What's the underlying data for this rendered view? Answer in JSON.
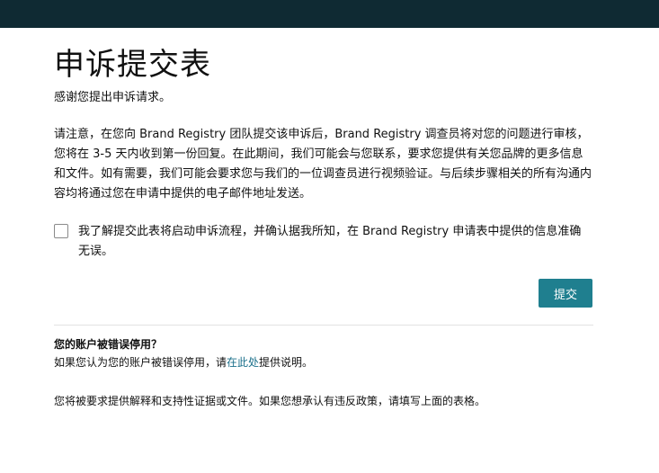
{
  "header": {
    "bar_color": "#0f2a33"
  },
  "page": {
    "title": "申诉提交表",
    "thanks": "感谢您提出申诉请求。",
    "notice": "请注意，在您向 Brand Registry 团队提交该申诉后，Brand Registry 调查员将对您的问题进行审核，您将在 3-5 天内收到第一份回复。在此期间，我们可能会与您联系，要求您提供有关您品牌的更多信息和文件。如有需要，我们可能会要求您与我们的一位调查员进行视频验证。与后续步骤相关的所有沟通内容均将通过您在申请中提供的电子邮件地址发送。"
  },
  "acknowledgement": {
    "checked": false,
    "label": "我了解提交此表将启动申诉流程，并确认据我所知，在 Brand Registry 申请表中提供的信息准确无误。"
  },
  "actions": {
    "submit_label": "提交",
    "submit_color": "#1f7f8f"
  },
  "account_disabled": {
    "heading": "您的账户被错误停用？",
    "desc_before": "如果您认为您的账户被错误停用，请",
    "link_text": "在此处",
    "desc_after": "提供说明。",
    "footer": "您将被要求提供解释和支持性证据或文件。如果您想承认有违反政策，请填写上面的表格。"
  }
}
